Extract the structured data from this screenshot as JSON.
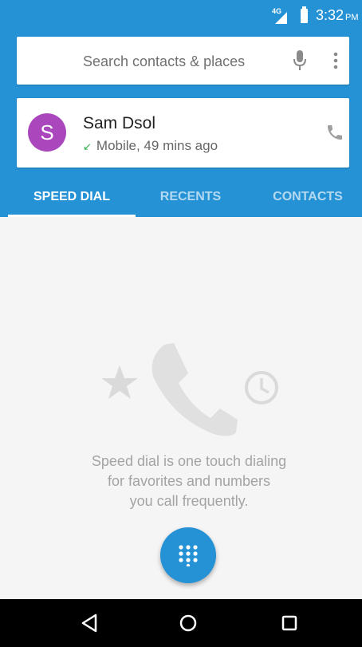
{
  "status_bar": {
    "network": "4G",
    "time": "3:32",
    "ampm": "PM"
  },
  "search": {
    "placeholder": "Search contacts & places"
  },
  "recent_call": {
    "avatar_letter": "S",
    "name": "Sam Dsol",
    "detail": "Mobile, 49 mins ago",
    "call_type_icon": "incoming-call-arrow-icon"
  },
  "tabs": [
    {
      "label": "SPEED DIAL",
      "active": true
    },
    {
      "label": "RECENTS",
      "active": false
    },
    {
      "label": "CONTACTS",
      "active": false
    }
  ],
  "empty_state": {
    "line1": "Speed dial is one touch dialing",
    "line2": "for favorites and numbers",
    "line3": "you call frequently."
  },
  "colors": {
    "primary": "#2592d6",
    "avatar": "#ab47bc",
    "incoming": "#2db34a"
  },
  "icons": {
    "search": "search-icon",
    "mic": "mic-icon",
    "overflow": "more-vert-icon",
    "call": "phone-icon",
    "fab": "dialpad-icon",
    "nav": [
      "back-icon",
      "home-icon",
      "recents-icon"
    ]
  }
}
